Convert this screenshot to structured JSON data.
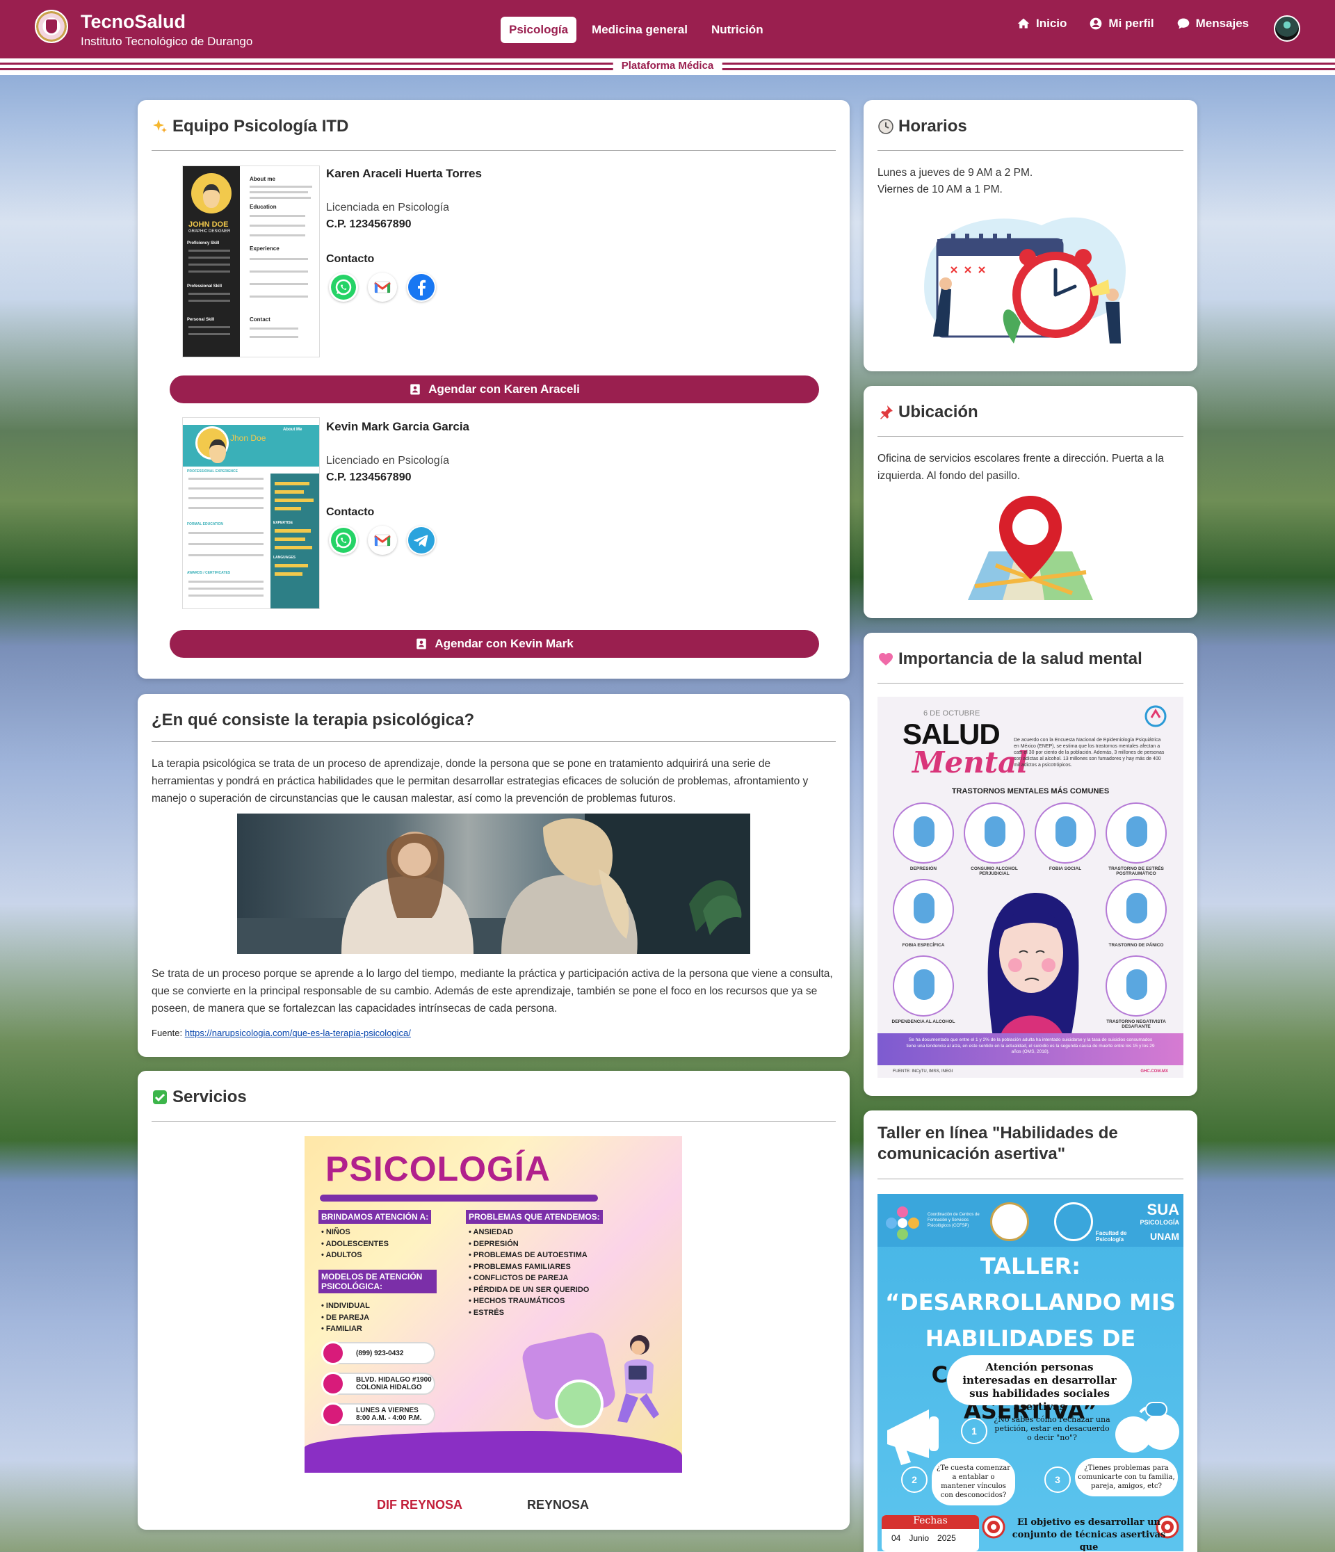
{
  "header": {
    "brand_title": "TecnoSalud",
    "brand_subtitle": "Instituto Tecnológico de Durango",
    "tabs": [
      {
        "label": "Psicología",
        "active": true
      },
      {
        "label": "Medicina general",
        "active": false
      },
      {
        "label": "Nutrición",
        "active": false
      }
    ],
    "right_links": [
      {
        "label": "Inicio",
        "icon": "home-icon"
      },
      {
        "label": "Mi perfil",
        "icon": "user-circle-icon"
      },
      {
        "label": "Mensajes",
        "icon": "chat-bubble-icon"
      }
    ],
    "platform_label": "Plataforma Médica",
    "accent_color": "#9a1f4f"
  },
  "team": {
    "title": "Equipo Psicología ITD",
    "title_icon": "sparkles-icon",
    "members": [
      {
        "name": "Karen Araceli Huerta Torres",
        "role": "Licenciada en Psicología",
        "cp": "C.P. 1234567890",
        "contact_label": "Contacto",
        "contacts": [
          "whatsapp-icon",
          "gmail-icon",
          "facebook-icon"
        ],
        "button": "Agendar con Karen Araceli",
        "cv": {
          "name": "JOHN DOE",
          "title": "GRAPHIC DESIGNER",
          "sections": [
            "About me",
            "Education",
            "Experience",
            "Proficiency Skill",
            "Professional Skill",
            "Personal Skill",
            "Contact"
          ]
        }
      },
      {
        "name": "Kevin Mark Garcia Garcia",
        "role": "Licenciado en Psicología",
        "cp": "C.P. 1234567890",
        "contact_label": "Contacto",
        "contacts": [
          "whatsapp-icon",
          "gmail-icon",
          "telegram-icon"
        ],
        "button": "Agendar con Kevin Mark",
        "cv": {
          "name": "Jhon Doe",
          "sections": [
            "About Me",
            "PROFESSIONAL EXPERIENCE",
            "PROFESSIONAL SKILLS",
            "FORMAL EDUCATION",
            "EXPERTISE",
            "LANGUAGES",
            "AWARDS / CERTIFICATES"
          ]
        }
      }
    ]
  },
  "therapy": {
    "title": "¿En qué consiste la terapia psicológica?",
    "paragraph1": "La terapia psicológica se trata de un proceso de aprendizaje, donde la persona que se pone en tratamiento adquirirá una serie de herramientas y pondrá en práctica habilidades que le permitan desarrollar estrategias eficaces de solución de problemas, afrontamiento y manejo o superación de circunstancias que le causan malestar, así como la prevención de problemas futuros.",
    "paragraph2": "Se trata de un proceso porque se aprende a lo largo del tiempo, mediante la práctica y participación activa de la persona que viene a consulta, que se convierte en la principal responsable de su cambio. Además de este aprendizaje, también se pone el foco en los recursos que ya se poseen, de manera que se fortalezcan las capacidades intrínsecas de cada persona.",
    "source_label": "Fuente:",
    "source_link": "https://narupsicologia.com/que-es-la-terapia-psicologica/"
  },
  "services": {
    "title": "Servicios",
    "title_icon": "check-box-icon",
    "poster": {
      "title": "PSICOLOGÍA",
      "col1_header": "BRINDAMOS ATENCIÓN A:",
      "col1_items": [
        "• NIÑOS",
        "• ADOLESCENTES",
        "• ADULTOS"
      ],
      "col1b_header": "MODELOS DE ATENCIÓN PSICOLÓGICA:",
      "col1b_items": [
        "• INDIVIDUAL",
        "• DE PAREJA",
        "• FAMILIAR"
      ],
      "col2_header": "PROBLEMAS QUE ATENDEMOS:",
      "col2_items": [
        "• ANSIEDAD",
        "• DEPRESIÓN",
        "• PROBLEMAS DE AUTOESTIMA",
        "• PROBLEMAS FAMILIARES",
        "• CONFLICTOS DE PAREJA",
        "• PÉRDIDA DE UN SER QUERIDO",
        "• HECHOS TRAUMÁTICOS",
        "• ESTRÉS"
      ],
      "phone": "(899) 923-0432",
      "address": "BLVD. HIDALGO #1900 COLONIA HIDALGO",
      "hours": "LUNES A VIERNES 8:00 A.M. - 4:00 P.M."
    },
    "logo_left": "DIF REYNOSA",
    "logo_right": "REYNOSA"
  },
  "schedule": {
    "title": "Horarios",
    "title_icon": "clock-icon",
    "line1": "Lunes a jueves de 9 AM a 2 PM.",
    "line2": "Viernes de 10 AM a 1 PM."
  },
  "location": {
    "title": "Ubicación",
    "title_icon": "pushpin-icon",
    "text": "Oficina de servicios escolares frente a dirección. Puerta a la izquierda. Al fondo del pasillo."
  },
  "mental_health": {
    "title": "Importancia de la salud mental",
    "title_icon": "heart-icon",
    "poster": {
      "date": "6 DE OCTUBRE",
      "salud": "SALUD",
      "mental": "Mental",
      "intro": "De acuerdo con la Encuesta Nacional de Epidemiología Psiquiátrica en México (ENEP), se estima que los trastornos mentales afectan a casi el 30 por ciento de la población. Además, 3 millones de personas son adictas al alcohol. 13 millones son fumadores y hay más de 400 mil adictos a psicotrópicos.",
      "header": "TRASTORNOS MENTALES MÁS COMUNES",
      "disorders": [
        "DEPRESIÓN",
        "CONSUMO ALCOHOL PERJUDICIAL",
        "FOBIA SOCIAL",
        "TRASTORNO DE ESTRÉS POSTRAUMÁTICO",
        "FOBIA ESPECÍFICA",
        "TRASTORNO DE PÁNICO",
        "DEPENDENCIA AL ALCOHOL",
        "TRASTORNO NEGATIVISTA DESAFIANTE"
      ],
      "footer": "Se ha documentado que entre el 1 y 2% de la población adulta ha intentado suicidarse y la tasa de suicidios consumados tiene una tendencia al alza, en este sentido en la actualidad, el suicidio es la segunda causa de muerte entre los 15 y los 29 años (OMS, 2018).",
      "source": "FUENTE: INCyTU, IMSS, INEGI",
      "web": "GHC.COM.MX"
    }
  },
  "workshop": {
    "title": "Taller en línea \"Habilidades de comunicación asertiva\"",
    "poster": {
      "title_line1": "TALLER: “DESARROLLANDO MIS",
      "title_line2": "HABILIDADES DE",
      "title_line3": "COMUNICACIÓN ASERTIVA”",
      "audience": "Atención personas interesadas en desarrollar sus habilidades sociales asertivas",
      "q1": "¿No sabes cómo rechazar una petición, estar en desacuerdo o decir \"no\"?",
      "q2": "¿Te cuesta comenzar a entablar o mantener vínculos con desconocidos?",
      "q3": "¿Tienes problemas para comunicarte con tu familia, pareja, amigos, etc?",
      "calendar_label": "Fechas",
      "cal_day": "04",
      "cal_month": "Junio",
      "cal_year": "2025",
      "objective": "El objetivo es desarrollar un conjunto de técnicas asertivas que",
      "sua_logo": "SUA",
      "sua_small": "PSICOLOGÍA",
      "unam": "UNAM",
      "coordination": "Coordinación de Centros de Formación y Servicios Psicológicos (CCFSP)",
      "faculty": "Facultad de Psicología"
    }
  }
}
